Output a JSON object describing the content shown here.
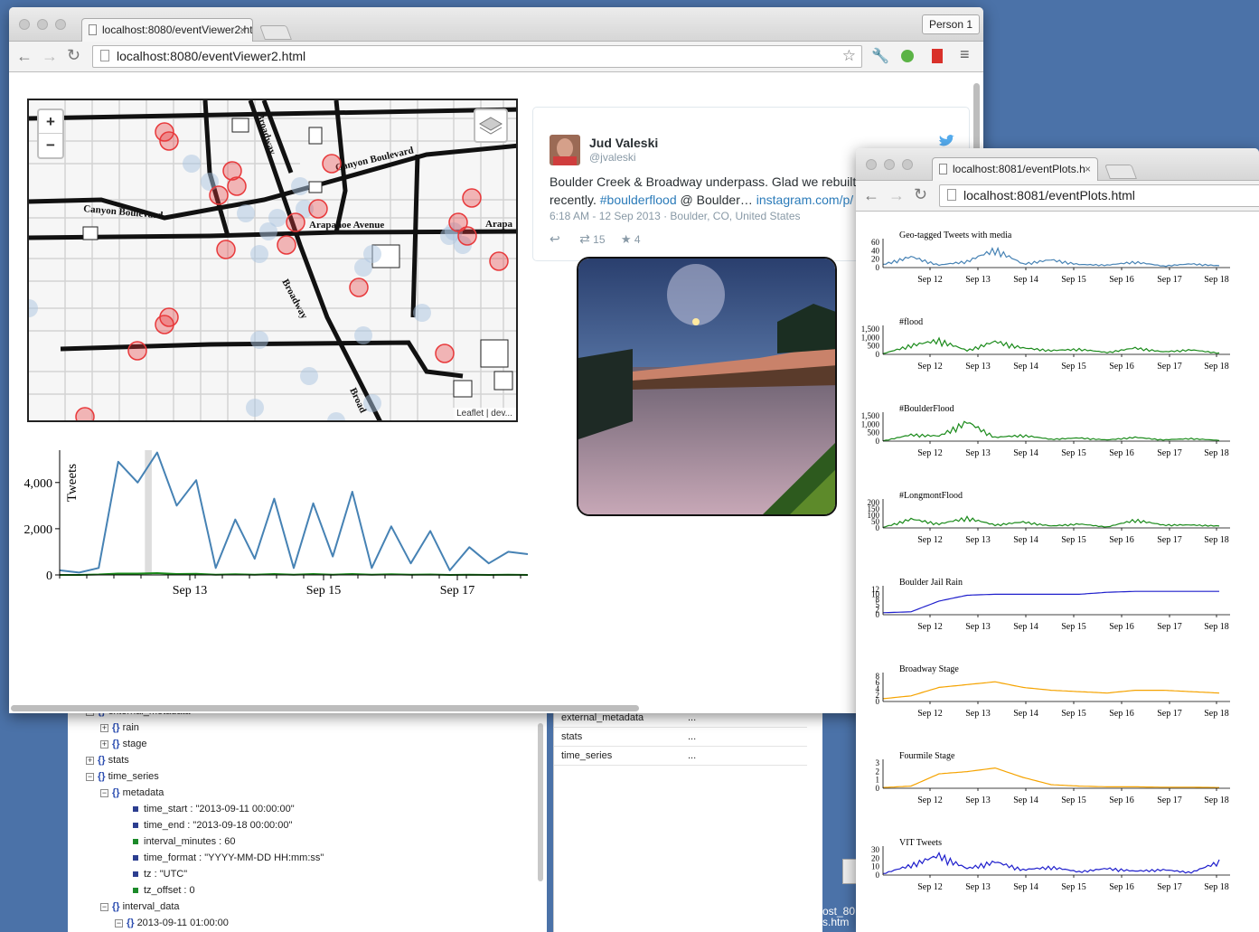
{
  "back_tree": {
    "rows": [
      {
        "label": "external_metadata",
        "kind": "obj",
        "expand": "−"
      },
      {
        "label": "rain",
        "kind": "obj",
        "expand": "+"
      },
      {
        "label": "stage",
        "kind": "obj",
        "expand": "+"
      },
      {
        "label": "stats",
        "kind": "obj",
        "expand": "+"
      },
      {
        "label": "time_series",
        "kind": "obj",
        "expand": "−"
      },
      {
        "label": "metadata",
        "kind": "obj",
        "expand": "−"
      },
      {
        "label": "time_start : \"2013-09-11 00:00:00\"",
        "kind": "str"
      },
      {
        "label": "time_end : \"2013-09-18 00:00:00\"",
        "kind": "str"
      },
      {
        "label": "interval_minutes : 60",
        "kind": "num"
      },
      {
        "label": "time_format : \"YYYY-MM-DD HH:mm:ss\"",
        "kind": "str"
      },
      {
        "label": "tz : \"UTC\"",
        "kind": "str"
      },
      {
        "label": "tz_offset : 0",
        "kind": "num"
      },
      {
        "label": "interval_data",
        "kind": "obj",
        "expand": "−"
      },
      {
        "label": "2013-09-11 01:00:00",
        "kind": "obj",
        "expand": "−"
      }
    ]
  },
  "back_props": {
    "rows": [
      {
        "key": "external_metadata",
        "value": "..."
      },
      {
        "key": "stats",
        "value": "..."
      },
      {
        "key": "time_series",
        "value": "..."
      }
    ]
  },
  "desktop_file": {
    "line1": "ost_80",
    "line2": "s.htm"
  },
  "main_window": {
    "tab_title": "localhost:8080/eventViewer2.html",
    "tab_close": "×",
    "url_host": "localhost",
    "url_path": ":8080/eventViewer2.html",
    "person_button": "Person 1",
    "map": {
      "zoom_in": "+",
      "zoom_out": "−",
      "attribution": "Leaflet | dev...",
      "street_labels": {
        "canyon1": "Canyon Boulevard",
        "canyon2": "Canyon Boulevard",
        "arapahoe1": "Arapahoe Avenue",
        "arapahoe2": "Arapa",
        "broadway1": "Broadway",
        "broadway2": "Broadway",
        "broadway3": "Broad"
      }
    },
    "tweet": {
      "name": "Jud Valeski",
      "handle": "@jvaleski",
      "text_line1": "Boulder Creek & Broadway underpass. Glad we rebuilt",
      "text_line2_pre": "recently. ",
      "hashtag": "#boulderflood",
      "text_line2_mid": " @ Boulder… ",
      "link": "instagram.com/p/",
      "meta": "6:18 AM - 12 Sep 2013 · Boulder, CO, United States",
      "reply_icon": "reply-icon",
      "retweet_count": "15",
      "favorite_count": "4"
    },
    "timeline_chart": {
      "ylabel": "Tweets",
      "yticks": [
        "4,000",
        "2,000",
        "0"
      ],
      "xticks": [
        "Sep 13",
        "Sep 15",
        "Sep 17"
      ]
    }
  },
  "plots_window": {
    "tab_title": "localhost:8081/eventPlots.h",
    "tab_close": "×",
    "url_host": "localhost",
    "url_path": ":8081/eventPlots.html",
    "xticks": [
      "Sep 12",
      "Sep 13",
      "Sep 14",
      "Sep 15",
      "Sep 16",
      "Sep 17",
      "Sep 18"
    ]
  },
  "chart_data": [
    {
      "type": "line",
      "title": "",
      "ylabel": "Tweets",
      "ylim": [
        0,
        5400
      ],
      "x": [
        "Sep 11 12:00",
        "Sep 12 00:00",
        "Sep 12 12:00",
        "Sep 12 18:00",
        "Sep 13 00:00",
        "Sep 13 06:00",
        "Sep 13 12:00",
        "Sep 13 18:00",
        "Sep 14 00:00",
        "Sep 14 06:00",
        "Sep 14 12:00",
        "Sep 14 18:00",
        "Sep 15 00:00",
        "Sep 15 06:00",
        "Sep 15 12:00",
        "Sep 15 18:00",
        "Sep 16 00:00",
        "Sep 16 06:00",
        "Sep 16 12:00",
        "Sep 16 18:00",
        "Sep 17 00:00",
        "Sep 17 06:00",
        "Sep 17 12:00",
        "Sep 17 18:00",
        "Sep 18 00:00"
      ],
      "series": [
        {
          "values": [
            200,
            100,
            300,
            4900,
            4000,
            5300,
            3000,
            4100,
            300,
            2400,
            700,
            3300,
            300,
            3100,
            800,
            3600,
            300,
            2100,
            500,
            1900,
            200,
            1200,
            500,
            1000,
            900
          ]
        },
        {
          "values": [
            0,
            0,
            20,
            60,
            60,
            80,
            40,
            50,
            10,
            30,
            10,
            40,
            10,
            40,
            10,
            40,
            10,
            30,
            10,
            20,
            0,
            10,
            0,
            10,
            0
          ]
        }
      ],
      "highlight_range": [
        "Sep 13 00:00",
        "Sep 13 06:00"
      ]
    },
    {
      "type": "line",
      "title": "Geo-tagged Tweets with media",
      "yticks": [
        "60",
        "40",
        "20",
        "0"
      ],
      "ylim": [
        0,
        70
      ],
      "categories": [
        "Sep 12",
        "Sep 13",
        "Sep 14",
        "Sep 15",
        "Sep 16",
        "Sep 17",
        "Sep 18"
      ],
      "series": [
        {
          "values": [
            10,
            35,
            8,
            20,
            58,
            12,
            25,
            10,
            8,
            18,
            5,
            12,
            6
          ]
        }
      ]
    },
    {
      "type": "line",
      "title": "#flood",
      "yticks": [
        "1,500",
        "1,000",
        "500",
        "0"
      ],
      "ylim": [
        0,
        1700
      ],
      "categories": [
        "Sep 12",
        "Sep 13",
        "Sep 14",
        "Sep 15",
        "Sep 16",
        "Sep 17",
        "Sep 18"
      ],
      "series": [
        {
          "values": [
            50,
            700,
            1100,
            300,
            1000,
            500,
            300,
            400,
            150,
            500,
            200,
            350,
            100
          ]
        }
      ]
    },
    {
      "type": "line",
      "title": "#BoulderFlood",
      "yticks": [
        "1,500",
        "1,000",
        "500",
        "0"
      ],
      "ylim": [
        0,
        1700
      ],
      "categories": [
        "Sep 12",
        "Sep 13",
        "Sep 14",
        "Sep 15",
        "Sep 16",
        "Sep 17",
        "Sep 18"
      ],
      "series": [
        {
          "values": [
            20,
            500,
            400,
            1500,
            300,
            450,
            150,
            250,
            100,
            300,
            100,
            200,
            60
          ]
        }
      ]
    },
    {
      "type": "line",
      "title": "#LongmontFlood",
      "yticks": [
        "200",
        "150",
        "100",
        "50",
        "0"
      ],
      "ylim": [
        0,
        220
      ],
      "categories": [
        "Sep 12",
        "Sep 13",
        "Sep 14",
        "Sep 15",
        "Sep 16",
        "Sep 17",
        "Sep 18"
      ],
      "series": [
        {
          "values": [
            5,
            90,
            40,
            100,
            30,
            60,
            20,
            40,
            10,
            80,
            30,
            30,
            20
          ]
        }
      ]
    },
    {
      "type": "line",
      "title": "Boulder Jail Rain",
      "yticks": [
        "12",
        "10",
        "8",
        "5",
        "2",
        "0"
      ],
      "ylim": [
        0,
        13
      ],
      "categories": [
        "Sep 12",
        "Sep 13",
        "Sep 14",
        "Sep 15",
        "Sep 16",
        "Sep 17",
        "Sep 18"
      ],
      "series": [
        {
          "values": [
            1,
            1.5,
            7,
            10,
            10.5,
            10.5,
            10.5,
            10.5,
            11.5,
            12,
            12,
            12,
            12
          ]
        }
      ]
    },
    {
      "type": "line",
      "title": "Broadway Stage",
      "yticks": [
        "8",
        "6",
        "4",
        "2",
        "0"
      ],
      "ylim": [
        0,
        9
      ],
      "categories": [
        "Sep 12",
        "Sep 13",
        "Sep 14",
        "Sep 15",
        "Sep 16",
        "Sep 17",
        "Sep 18"
      ],
      "series": [
        {
          "values": [
            1,
            2,
            5,
            6,
            7,
            5,
            4,
            3.5,
            3,
            4,
            4,
            3.5,
            3
          ]
        }
      ]
    },
    {
      "type": "line",
      "title": "Fourmile Stage",
      "yticks": [
        "3",
        "2",
        "1",
        "0"
      ],
      "ylim": [
        0,
        3.5
      ],
      "categories": [
        "Sep 12",
        "Sep 13",
        "Sep 14",
        "Sep 15",
        "Sep 16",
        "Sep 17",
        "Sep 18"
      ],
      "series": [
        {
          "values": [
            0.1,
            0.3,
            2,
            2.3,
            2.8,
            1.5,
            0.5,
            0.3,
            0.2,
            0.2,
            0.15,
            0.15,
            0.1
          ]
        }
      ]
    },
    {
      "type": "line",
      "title": "VIT Tweets",
      "yticks": [
        "30",
        "20",
        "10",
        "0"
      ],
      "ylim": [
        0,
        33
      ],
      "categories": [
        "Sep 12",
        "Sep 13",
        "Sep 14",
        "Sep 15",
        "Sep 16",
        "Sep 17",
        "Sep 18"
      ],
      "series": [
        {
          "values": [
            2,
            15,
            30,
            10,
            20,
            8,
            12,
            5,
            10,
            6,
            8,
            4,
            20
          ]
        }
      ]
    }
  ],
  "colors": {
    "desktop": "#4b72a8",
    "steel_blue": "#4682b4",
    "green": "#1a8a1a",
    "blue": "#1f1fcc",
    "orange": "#f5a300",
    "map_red": "#e8393b",
    "map_blue": "#a9c3df",
    "twitter_link": "#2b7bb9"
  }
}
